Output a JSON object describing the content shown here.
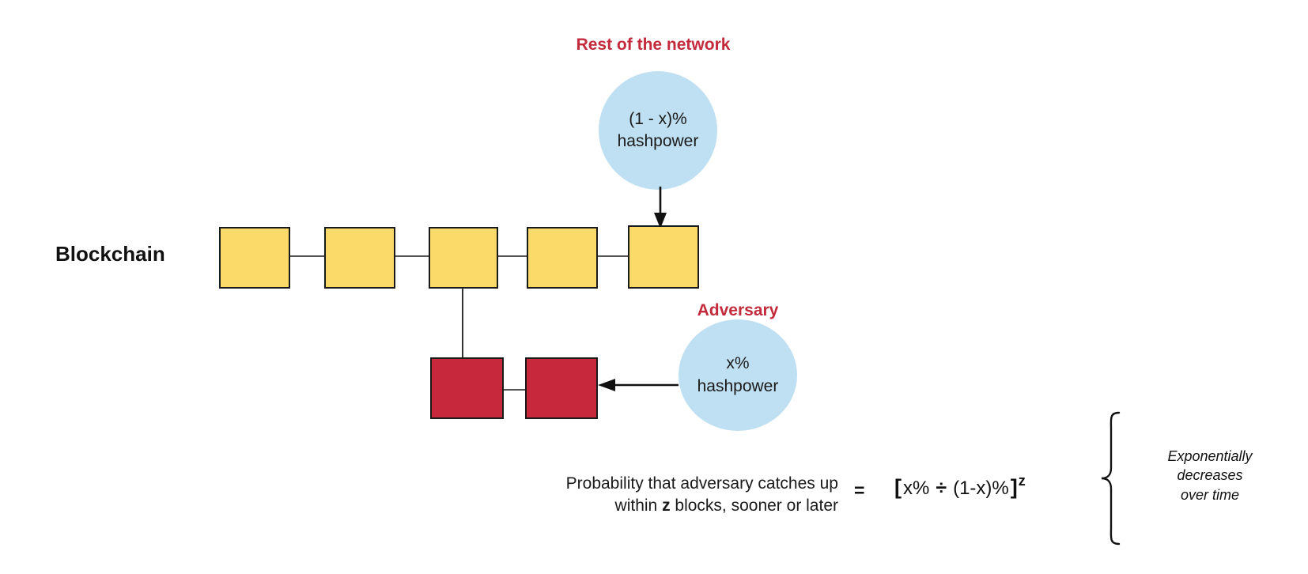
{
  "diagram": {
    "network": {
      "title": "Rest of the network",
      "circle_line1": "(1 - x)%",
      "circle_line2": "hashpower"
    },
    "adversary": {
      "title": "Adversary",
      "circle_line1": "x%",
      "circle_line2": "hashpower"
    },
    "chain": {
      "label": "Blockchain",
      "honest_blocks": [
        "",
        "",
        "",
        "",
        ""
      ],
      "adversary_blocks": [
        "",
        ""
      ]
    },
    "formula": {
      "description_line1": "Probability that adversary catches up",
      "description_line2_pre": "within ",
      "description_line2_var": "z",
      "description_line2_post": " blocks, sooner or later",
      "equals": "=",
      "bracket_open": "[",
      "numerator": "x%",
      "divide": "÷",
      "denominator": "(1-x)%",
      "bracket_close": "]",
      "exponent": "z"
    },
    "annotation": {
      "line1": "Exponentially",
      "line2": "decreases",
      "line3": "over time"
    },
    "colors": {
      "honest_block": "#FCDA69",
      "adversary_block": "#C8283C",
      "circle": "#BFE0F2",
      "heading": "#C32B3C"
    }
  }
}
